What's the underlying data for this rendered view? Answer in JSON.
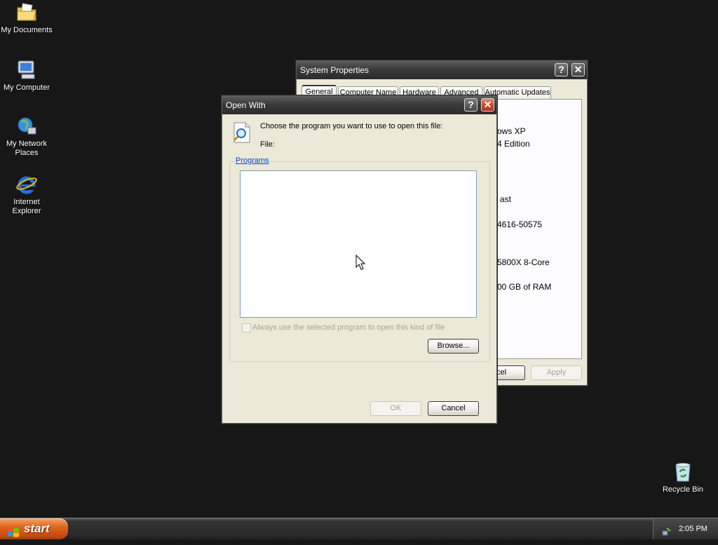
{
  "desktop": {
    "icons": [
      {
        "label": "My Documents",
        "icon": "folder-documents-icon"
      },
      {
        "label": "My Computer",
        "icon": "computer-icon"
      },
      {
        "label": "My Network Places",
        "icon": "network-places-icon"
      },
      {
        "label": "Internet Explorer",
        "icon": "internet-explorer-icon"
      },
      {
        "label": "Recycle Bin",
        "icon": "recycle-bin-icon"
      }
    ]
  },
  "system_properties": {
    "title": "System Properties",
    "help_glyph": "?",
    "close_glyph": "✕",
    "tabs": [
      "General",
      "Computer Name",
      "Hardware",
      "Advanced",
      "Automatic Updates"
    ],
    "visible_text": [
      "ows XP",
      "4 Edition",
      "ast",
      "4616-50575",
      "5800X 8-Core",
      "00 GB of RAM"
    ],
    "buttons": {
      "cancel_partial": "ncel",
      "apply": "Apply"
    }
  },
  "open_with": {
    "title": "Open With",
    "help_glyph": "?",
    "close_glyph": "✕",
    "prompt": "Choose the program you want to use to open this file:",
    "file_label": "File:",
    "programs_label": "Programs",
    "always_use_label": "Always use the selected program to open this kind of file",
    "always_use_checked": false,
    "browse_label": "Browse...",
    "ok_label": "OK",
    "cancel_label": "Cancel"
  },
  "taskbar": {
    "start_label": "start",
    "clock": "2:05 PM"
  },
  "colors": {
    "desktop": "#171717",
    "window_face": "#ece9d8",
    "start_button": "#e0661e",
    "close_button": "#c9452a",
    "link_blue": "#0046d5"
  }
}
